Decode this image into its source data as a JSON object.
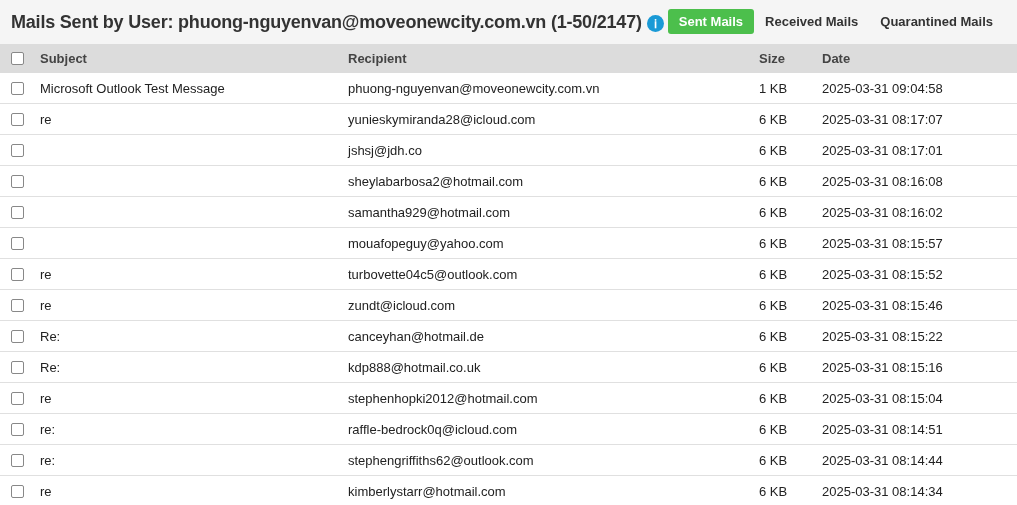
{
  "header": {
    "title": "Mails Sent by User: phuong-nguyenvan@moveonewcity.com.vn (1-50/2147)",
    "info_icon": "ℹ",
    "tabs": [
      {
        "label": "Sent Mails",
        "selected": true
      },
      {
        "label": "Received Mails",
        "selected": false
      },
      {
        "label": "Quarantined Mails",
        "selected": false
      }
    ]
  },
  "table": {
    "select_all": {
      "checked": false
    },
    "columns": [
      "Subject",
      "Recipient",
      "Size",
      "Date"
    ],
    "rows": [
      {
        "checked": false,
        "subject": "Microsoft Outlook Test Message",
        "recipient": "phuong-nguyenvan@moveonewcity.com.vn",
        "size": "1 KB",
        "date": "2025-03-31 09:04:58"
      },
      {
        "checked": false,
        "subject": "re",
        "recipient": "yunieskymiranda28@icloud.com",
        "size": "6 KB",
        "date": "2025-03-31 08:17:07"
      },
      {
        "checked": false,
        "subject": "",
        "recipient": "jshsj@jdh.co",
        "size": "6 KB",
        "date": "2025-03-31 08:17:01"
      },
      {
        "checked": false,
        "subject": "",
        "recipient": "sheylabarbosa2@hotmail.com",
        "size": "6 KB",
        "date": "2025-03-31 08:16:08"
      },
      {
        "checked": false,
        "subject": "",
        "recipient": "samantha929@hotmail.com",
        "size": "6 KB",
        "date": "2025-03-31 08:16:02"
      },
      {
        "checked": false,
        "subject": "",
        "recipient": "mouafopeguy@yahoo.com",
        "size": "6 KB",
        "date": "2025-03-31 08:15:57"
      },
      {
        "checked": false,
        "subject": "re",
        "recipient": "turbovette04c5@outlook.com",
        "size": "6 KB",
        "date": "2025-03-31 08:15:52"
      },
      {
        "checked": false,
        "subject": "re",
        "recipient": "zundt@icloud.com",
        "size": "6 KB",
        "date": "2025-03-31 08:15:46"
      },
      {
        "checked": false,
        "subject": "Re:",
        "recipient": "canceyhan@hotmail.de",
        "size": "6 KB",
        "date": "2025-03-31 08:15:22"
      },
      {
        "checked": false,
        "subject": "Re:",
        "recipient": "kdp888@hotmail.co.uk",
        "size": "6 KB",
        "date": "2025-03-31 08:15:16"
      },
      {
        "checked": false,
        "subject": "re",
        "recipient": "stephenhopki2012@hotmail.com",
        "size": "6 KB",
        "date": "2025-03-31 08:15:04"
      },
      {
        "checked": false,
        "subject": "re:",
        "recipient": "raffle-bedrock0q@icloud.com",
        "size": "6 KB",
        "date": "2025-03-31 08:14:51"
      },
      {
        "checked": false,
        "subject": "re:",
        "recipient": "stephengriffiths62@outlook.com",
        "size": "6 KB",
        "date": "2025-03-31 08:14:44"
      },
      {
        "checked": false,
        "subject": "re",
        "recipient": "kimberlystarr@hotmail.com",
        "size": "6 KB",
        "date": "2025-03-31 08:14:34"
      }
    ]
  }
}
